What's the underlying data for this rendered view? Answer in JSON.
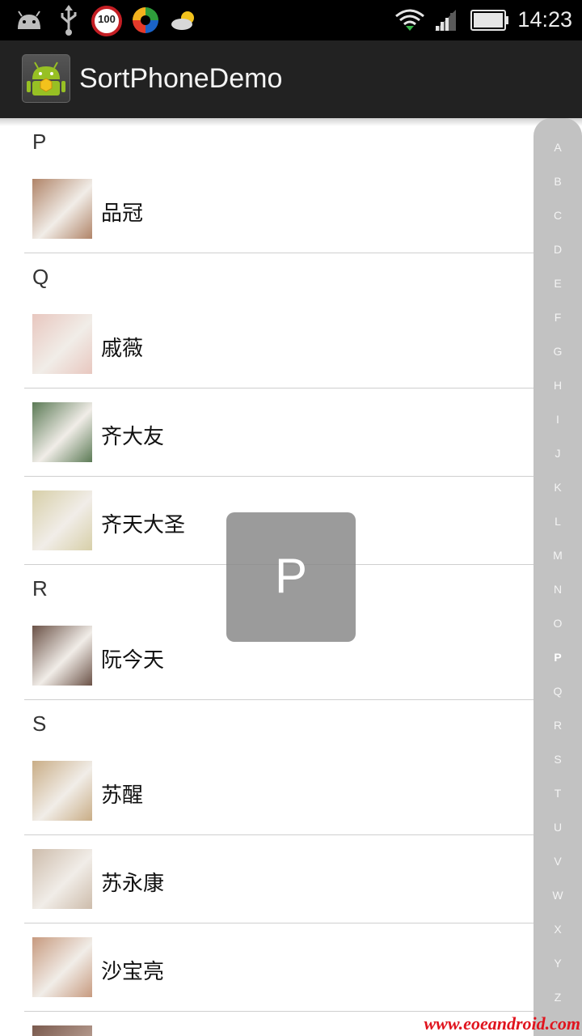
{
  "status_bar": {
    "time": "14:23",
    "battery_badge": "100",
    "icons": [
      "android-icon",
      "usb-icon",
      "battery-badge-icon",
      "app-circle-icon",
      "weather-icon",
      "wifi-icon",
      "signal-icon",
      "battery-icon"
    ]
  },
  "action_bar": {
    "title": "SortPhoneDemo",
    "icon": "android-app-icon"
  },
  "list": {
    "sections": [
      {
        "letter": "P",
        "rows": [
          {
            "name": "品冠",
            "avatar_color": "#b08468"
          }
        ]
      },
      {
        "letter": "Q",
        "rows": [
          {
            "name": "戚薇",
            "avatar_color": "#e8c7bf"
          },
          {
            "name": "齐大友",
            "avatar_color": "#5b7a55"
          },
          {
            "name": "齐天大圣",
            "avatar_color": "#d7cfa8"
          }
        ]
      },
      {
        "letter": "R",
        "rows": [
          {
            "name": "阮今天",
            "avatar_color": "#6b5247"
          }
        ]
      },
      {
        "letter": "S",
        "rows": [
          {
            "name": "苏醒",
            "avatar_color": "#c9ad86"
          },
          {
            "name": "苏永康",
            "avatar_color": "#cdbcab"
          },
          {
            "name": "沙宝亮",
            "avatar_color": "#c79a7f"
          }
        ]
      }
    ]
  },
  "side_index": {
    "letters": [
      "A",
      "B",
      "C",
      "D",
      "E",
      "F",
      "G",
      "H",
      "I",
      "J",
      "K",
      "L",
      "M",
      "N",
      "O",
      "P",
      "Q",
      "R",
      "S",
      "T",
      "U",
      "V",
      "W",
      "X",
      "Y",
      "Z"
    ],
    "active": "P"
  },
  "overlay": {
    "letter": "P"
  },
  "watermark": "www.eoeandroid.com",
  "colors": {
    "action_bar": "#222222",
    "sidebar": "#c2c2c2",
    "overlay": "#8a8a8a",
    "divider": "#cfcfcf"
  }
}
